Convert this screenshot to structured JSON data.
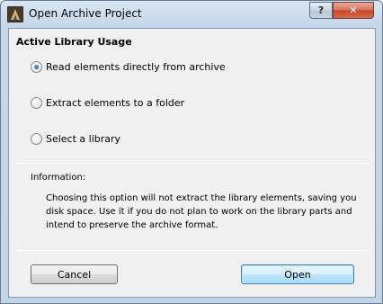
{
  "window": {
    "title": "Open Archive Project",
    "help_label": "?",
    "close_label": "✕"
  },
  "section": {
    "title": "Active Library Usage"
  },
  "options": [
    {
      "label": "Read elements directly from archive",
      "checked": true
    },
    {
      "label": "Extract elements to a folder",
      "checked": false
    },
    {
      "label": "Select a library",
      "checked": false
    }
  ],
  "information": {
    "label": "Information:",
    "text": "Choosing this option will not extract the library elements, saving you disk space. Use it if you do not plan to work on the library parts and intend to preserve the archive format."
  },
  "buttons": {
    "cancel": "Cancel",
    "open": "Open"
  },
  "icons": {
    "app": "archicad-app-icon",
    "help": "help-icon",
    "close": "close-icon"
  }
}
